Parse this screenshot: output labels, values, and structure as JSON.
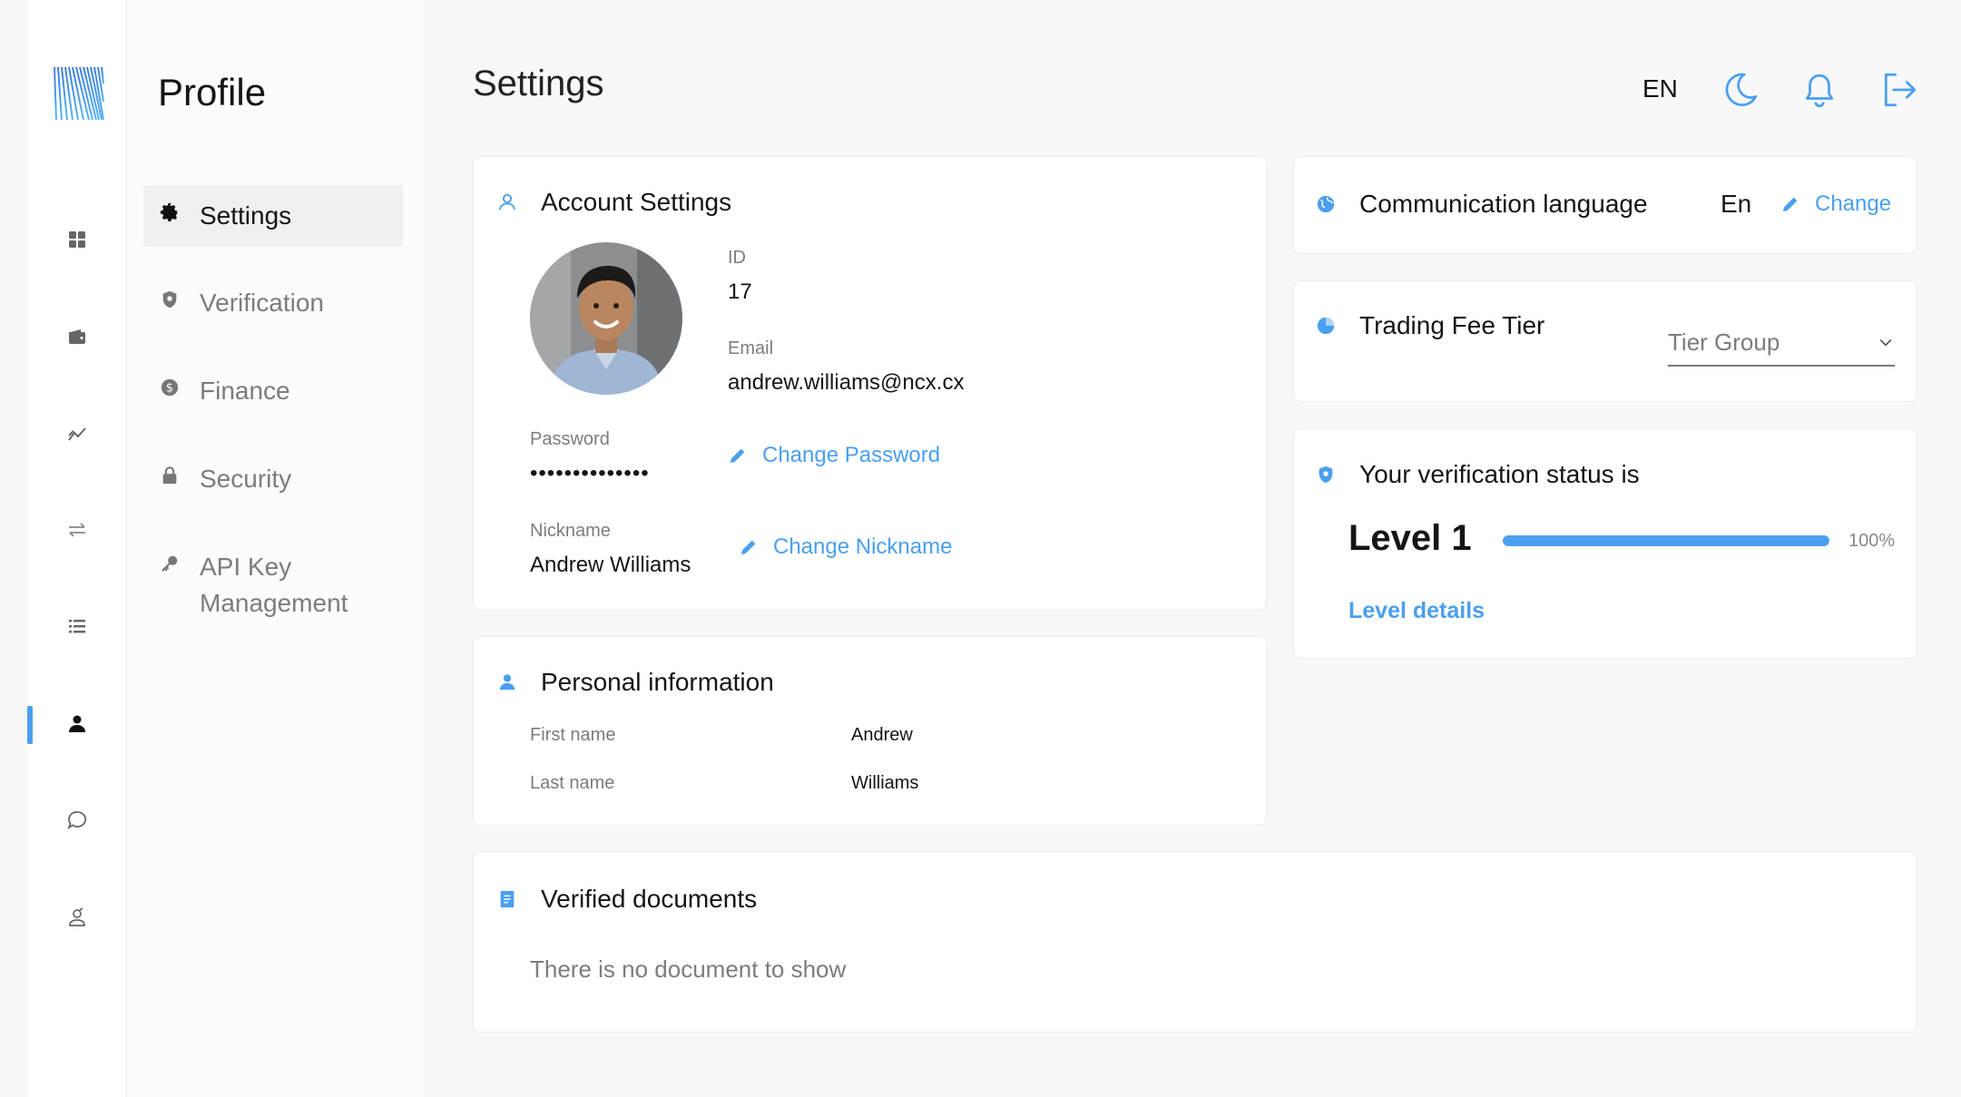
{
  "app": {
    "section_title": "Profile",
    "page_title": "Settings",
    "brand_color": "#4a9ff0"
  },
  "rail": {
    "items": [
      {
        "icon": "dashboard-grid-icon"
      },
      {
        "icon": "wallet-icon"
      },
      {
        "icon": "chart-trend-icon"
      },
      {
        "icon": "swap-arrows-icon"
      },
      {
        "icon": "list-icon"
      },
      {
        "icon": "user-icon",
        "active": true
      },
      {
        "icon": "chat-bubble-icon"
      },
      {
        "icon": "referral-users-icon"
      }
    ]
  },
  "sidebar": {
    "items": [
      {
        "label": "Settings",
        "icon": "gear-icon",
        "active": true
      },
      {
        "label": "Verification",
        "icon": "shield-icon"
      },
      {
        "label": "Finance",
        "icon": "dollar-coin-icon"
      },
      {
        "label": "Security",
        "icon": "lock-icon"
      },
      {
        "label": "API Key Management",
        "icon": "key-icon"
      }
    ]
  },
  "header": {
    "language": "EN",
    "icons": [
      "moon-icon",
      "bell-icon",
      "logout-icon"
    ]
  },
  "account": {
    "title": "Account Settings",
    "id_label": "ID",
    "id_value": "17",
    "email_label": "Email",
    "email_value": "andrew.williams@ncx.cx",
    "password_label": "Password",
    "password_value": "••••••••••••••",
    "change_password": "Change Password",
    "nickname_label": "Nickname",
    "nickname_value": "Andrew Williams",
    "change_nickname": "Change Nickname"
  },
  "personal": {
    "title": "Personal information",
    "first_name_label": "First name",
    "first_name_value": "Andrew",
    "last_name_label": "Last name",
    "last_name_value": "Williams"
  },
  "documents": {
    "title": "Verified documents",
    "empty_text": "There is no document to show"
  },
  "communication": {
    "title": "Communication language",
    "value": "En",
    "change_label": "Change"
  },
  "fee_tier": {
    "title": "Trading Fee Tier",
    "selected": "Tier Group"
  },
  "verification": {
    "title": "Your verification status is",
    "level": "Level 1",
    "progress_label": "100%",
    "progress": 1.0,
    "details_link": "Level details"
  }
}
